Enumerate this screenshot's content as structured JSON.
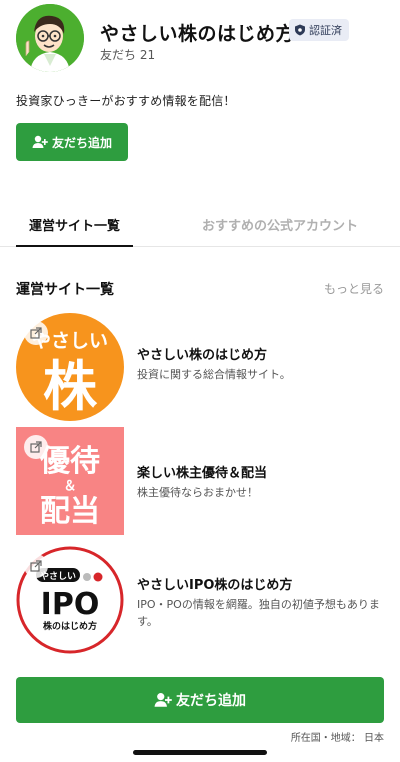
{
  "account": {
    "name": "やさしい株のはじめ方",
    "verified_label": "認証済",
    "friends_label": "友だち",
    "friends_count": "21",
    "description": "投資家ひっきーがおすすめ情報を配信！"
  },
  "add_friend_label": "友だち追加",
  "tabs": [
    {
      "label": "運営サイト一覧",
      "active": true
    },
    {
      "label": "おすすめの公式アカウント",
      "active": false
    }
  ],
  "section": {
    "title": "運営サイト一覧",
    "see_more": "もっと見る"
  },
  "sites": [
    {
      "title": "やさしい株のはじめ方",
      "description": "投資に関する総合情報サイト。",
      "thumb_text_top": "やさしい",
      "thumb_text_main": "株",
      "thumb_color": "#f7941d"
    },
    {
      "title": "楽しい株主優待＆配当",
      "description": "株主優待ならおまかせ！",
      "thumb_text_top": "優待",
      "thumb_text_mid": "＆",
      "thumb_text_bottom": "配当",
      "thumb_color": "#f88484"
    },
    {
      "title": "やさしいIPO株のはじめ方",
      "description": "IPO・POの情報を網羅。独自の初値予想もあります。",
      "thumb_text_top": "やさしい",
      "thumb_text_main": "IPO",
      "thumb_text_bottom": "株のはじめ方",
      "thumb_color": "#d7262a"
    }
  ],
  "location": "所在国・地域： 日本",
  "colors": {
    "accent_green": "#2e9d3f"
  }
}
